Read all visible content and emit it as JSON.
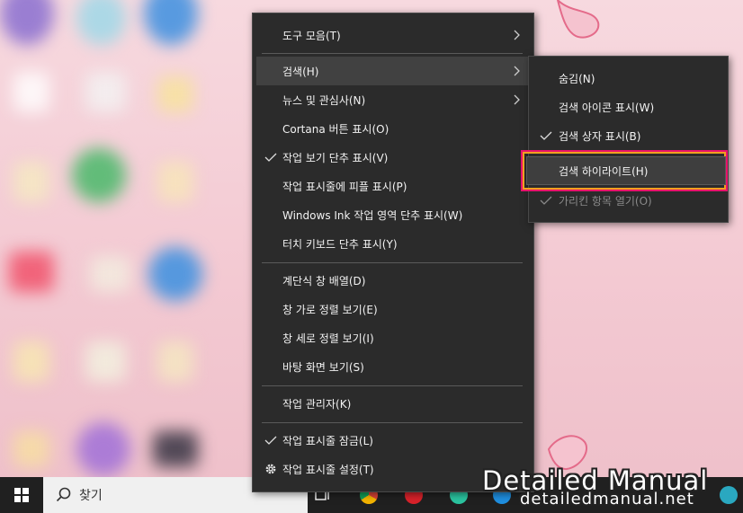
{
  "colors": {
    "menu_bg": "#2b2b2b",
    "highlight_border": "#e8136b",
    "highlight_accent": "#f0a020",
    "taskbar_bg": "#202020"
  },
  "taskbar": {
    "search_placeholder": "찾기",
    "apps": [
      "task-view-icon",
      "chrome-icon",
      "opera-icon",
      "app-icon",
      "edge-icon",
      "app-icon"
    ]
  },
  "context_menu": {
    "items": [
      {
        "label": "도구 모음(T)",
        "has_submenu": true,
        "checked": false
      },
      {
        "label": "검색(H)",
        "has_submenu": true,
        "checked": false,
        "hovered": true
      },
      {
        "label": "뉴스 및 관심사(N)",
        "has_submenu": true,
        "checked": false
      },
      {
        "label": "Cortana 버튼 표시(O)",
        "has_submenu": false,
        "checked": false
      },
      {
        "label": "작업 보기 단추 표시(V)",
        "has_submenu": false,
        "checked": true
      },
      {
        "label": "작업 표시줄에 피플 표시(P)",
        "has_submenu": false,
        "checked": false
      },
      {
        "label": "Windows Ink 작업 영역 단추 표시(W)",
        "has_submenu": false,
        "checked": false
      },
      {
        "label": "터치 키보드 단추 표시(Y)",
        "has_submenu": false,
        "checked": false
      },
      {
        "label": "계단식 창 배열(D)",
        "has_submenu": false,
        "checked": false
      },
      {
        "label": "창 가로 정렬 보기(E)",
        "has_submenu": false,
        "checked": false
      },
      {
        "label": "창 세로 정렬 보기(I)",
        "has_submenu": false,
        "checked": false
      },
      {
        "label": "바탕 화면 보기(S)",
        "has_submenu": false,
        "checked": false
      },
      {
        "label": "작업 관리자(K)",
        "has_submenu": false,
        "checked": false
      },
      {
        "label": "작업 표시줄 잠금(L)",
        "has_submenu": false,
        "checked": true
      },
      {
        "label": "작업 표시줄 설정(T)",
        "has_submenu": false,
        "checked": false,
        "icon": "gear-icon"
      }
    ]
  },
  "search_submenu": {
    "items": [
      {
        "label": "숨김(N)",
        "checked": false
      },
      {
        "label": "검색 아이콘 표시(W)",
        "checked": false
      },
      {
        "label": "검색 상자 표시(B)",
        "checked": true
      },
      {
        "label": "검색 하이라이트(H)",
        "checked": false,
        "highlighted": true
      },
      {
        "label": "가리킨 항목 열기(O)",
        "checked": true,
        "disabled": true
      }
    ]
  },
  "watermark": {
    "title": "Detailed Manual",
    "url": "detailedmanual.net"
  }
}
